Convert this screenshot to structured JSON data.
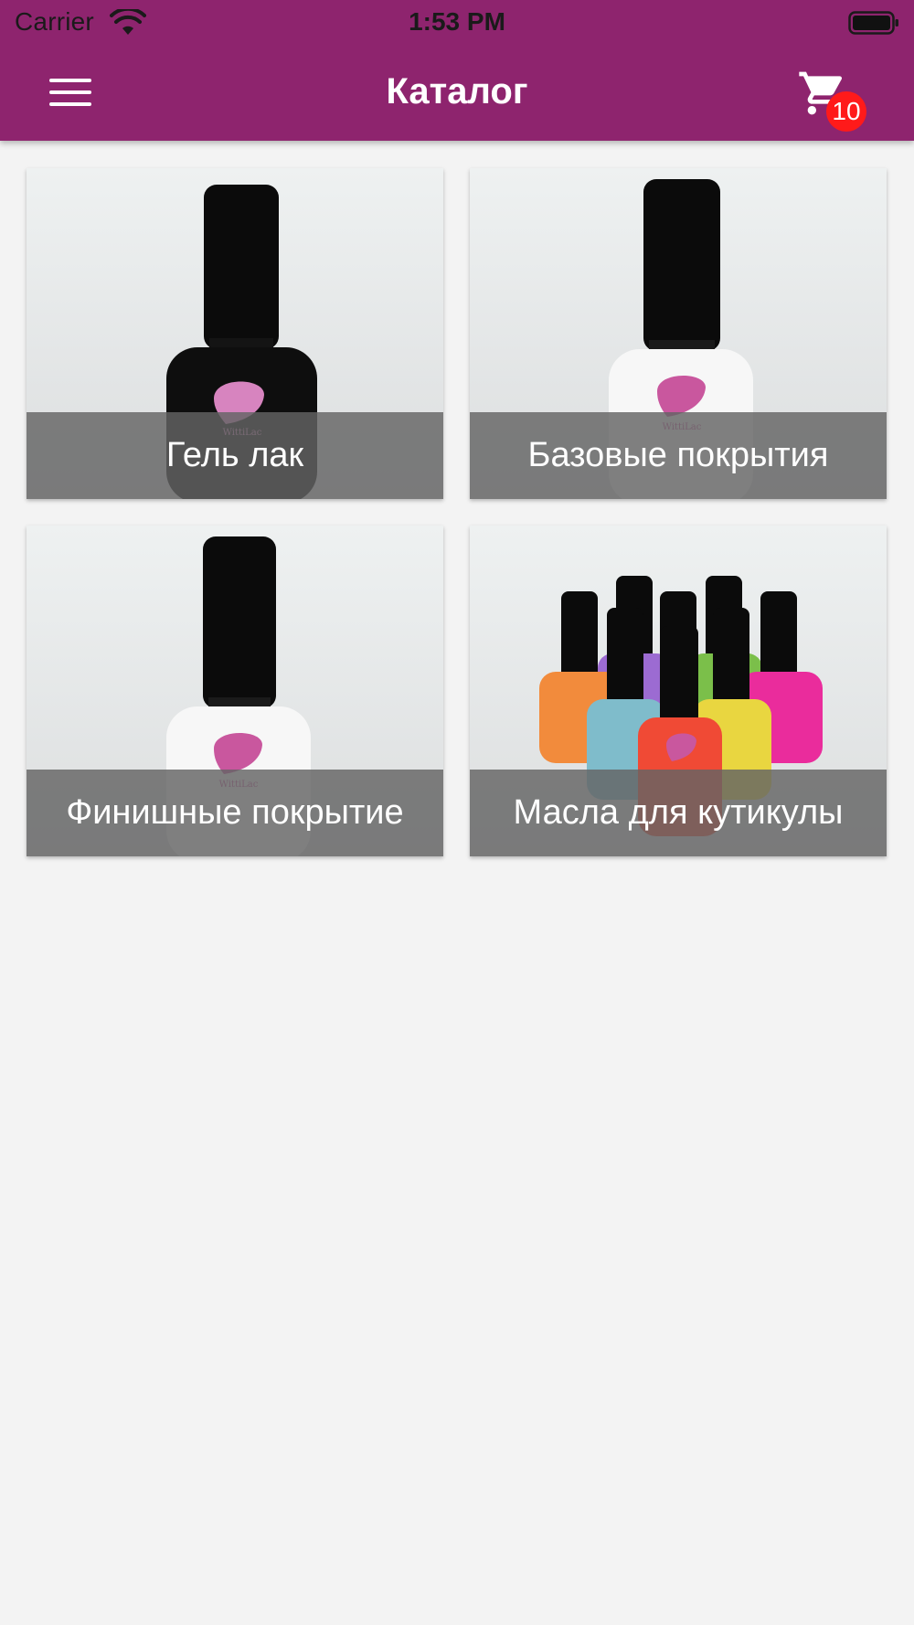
{
  "status_bar": {
    "carrier": "Carrier",
    "time": "1:53 PM",
    "wifi_icon": "wifi-icon",
    "battery_icon": "battery-icon"
  },
  "header": {
    "title": "Каталог",
    "menu_icon": "hamburger-menu-icon",
    "cart_icon": "shopping-cart-icon",
    "cart_count": "10",
    "background_color": "#8e246e",
    "badge_color": "#ff1a1a"
  },
  "catalog": {
    "categories": [
      {
        "label": "Гель лак"
      },
      {
        "label": "Базовые покрытия"
      },
      {
        "label": "Финишные покрытие"
      },
      {
        "label": "Масла для кутикулы"
      }
    ]
  }
}
